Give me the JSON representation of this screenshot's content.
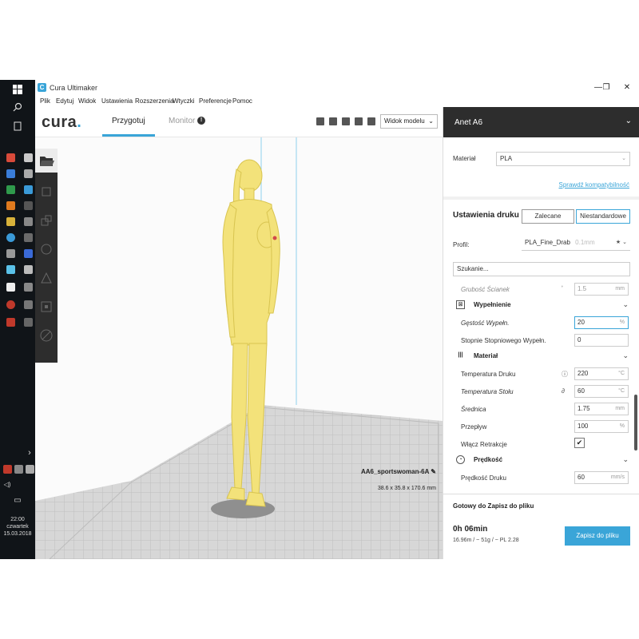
{
  "window": {
    "title": "Cura Ultimaker",
    "logo_letter": "C",
    "minimize": "—",
    "maximize": "❐",
    "close": "✕"
  },
  "menu": [
    "Plik",
    "Edytuj",
    "Widok",
    "Ustawienia",
    "Rozszerzenia",
    "Wtyczki",
    "Preferencje",
    "Pomoc"
  ],
  "header": {
    "logo": "cura",
    "logo_dot": ".",
    "tab_prepare": "Przygotuj",
    "tab_monitor": "Monitor",
    "monitor_badge": "!",
    "view_mode": "Widok modelu"
  },
  "model": {
    "name": "AA6_sportswoman-6A",
    "dimensions": "38.6 x 35.8 x 170.6 mm"
  },
  "panel": {
    "printer": "Anet A6",
    "material_label": "Materiał",
    "material_value": "PLA",
    "compat_link": "Sprawdź kompatybilność",
    "settings_title": "Ustawienia druku",
    "mode_recommended": "Zalecane",
    "mode_custom": "Niestandardowe",
    "profile_label": "Profil:",
    "profile_value": "PLA_Fine_Drab",
    "profile_suffix": "0.1mm",
    "search_value": "Szukanie...",
    "rows": {
      "wall_thickness": {
        "label": "Grubość Ścianek",
        "value": "1.5",
        "unit": "mm"
      },
      "infill_cat": "Wypełnienie",
      "infill_density": {
        "label": "Gęstość Wypełn.",
        "value": "20",
        "unit": "%"
      },
      "gradual_infill": {
        "label": "Stopnie Stopniowego Wypełn.",
        "value": "0"
      },
      "material_cat": "Materiał",
      "print_temp": {
        "label": "Temperatura Druku",
        "value": "220",
        "unit": "°C"
      },
      "bed_temp": {
        "label": "Temperatura Stołu",
        "value": "60",
        "unit": "°C"
      },
      "diameter": {
        "label": "Średnica",
        "value": "1.75",
        "unit": "mm"
      },
      "flow": {
        "label": "Przepływ",
        "value": "100",
        "unit": "%"
      },
      "retraction": {
        "label": "Włącz Retrakcje",
        "checked": "✔"
      },
      "speed_cat": "Prędkość",
      "print_speed": {
        "label": "Prędkość Druku",
        "value": "60",
        "unit": "mm/s"
      }
    },
    "ready_text": "Gotowy do Zapisz do pliku",
    "print_time": "0h 06min",
    "material_usage": "16.96m / ~ 51g / ~ PL 2.28",
    "save_button": "Zapisz do pliku"
  },
  "taskbar": {
    "time": "22:00",
    "day": "czwartek",
    "date": "15.03.2018"
  },
  "colors": {
    "accent": "#3aa5d8",
    "model": "#f3e27a",
    "dark": "#2d2d2d"
  }
}
